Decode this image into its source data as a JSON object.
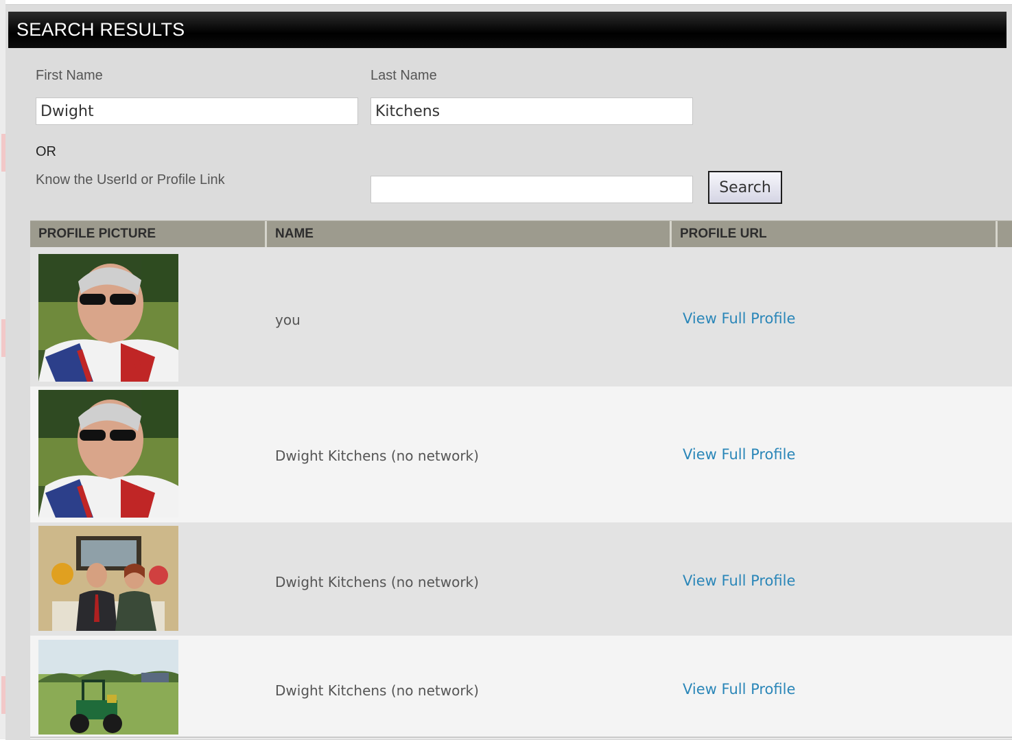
{
  "header": {
    "title": "SEARCH RESULTS"
  },
  "form": {
    "first_name_label": "First Name",
    "first_name_value": "Dwight",
    "last_name_label": "Last Name",
    "last_name_value": "Kitchens",
    "or_label": "OR",
    "userid_label": "Know the UserId or Profile Link",
    "userid_value": "",
    "search_label": "Search"
  },
  "table": {
    "columns": [
      "PROFILE PICTURE",
      "NAME",
      "PROFILE URL"
    ],
    "rows": [
      {
        "picture": "man-with-sunglasses-photo",
        "name": "you",
        "link": "View Full Profile"
      },
      {
        "picture": "man-with-sunglasses-photo",
        "name": "Dwight Kitchens (no network)",
        "link": "View Full Profile"
      },
      {
        "picture": "couple-indoor-photo",
        "name": "Dwight Kitchens (no network)",
        "link": "View Full Profile"
      },
      {
        "picture": "tractor-on-lawn-photo",
        "name": "Dwight Kitchens (no network)",
        "link": "View Full Profile"
      }
    ]
  },
  "colors": {
    "header_bg": "#000000",
    "table_head_bg": "#9d9b8e",
    "link": "#2a86b8",
    "panel_bg": "#dcdcdc"
  }
}
